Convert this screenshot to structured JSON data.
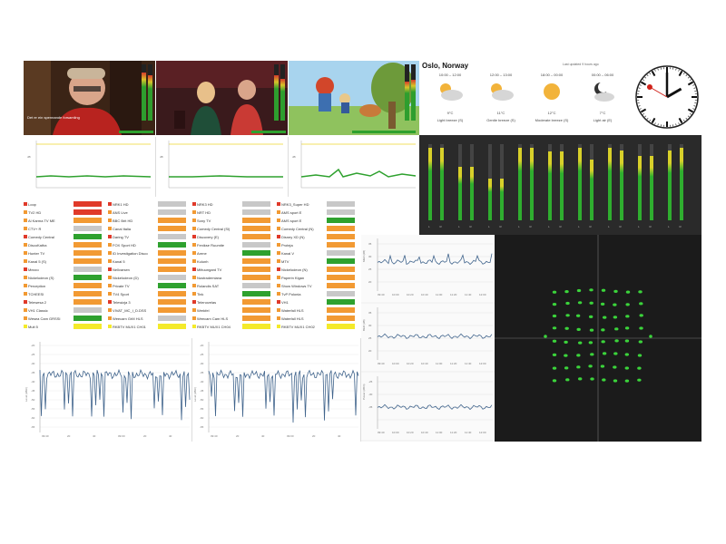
{
  "weather": {
    "city": "Oslo, Norway",
    "updated": "Last updated 9 hours ago",
    "periods": [
      {
        "time": "10:00 – 12:00",
        "temp": "9°C",
        "wind": "Light breeze (S)",
        "icon": "partly-cloudy-icon"
      },
      {
        "time": "12:00 – 13:00",
        "temp": "11°C",
        "wind": "Gentle breeze (S)",
        "icon": "partly-cloudy-icon"
      },
      {
        "time": "18:00 – 00:00",
        "temp": "12°C",
        "wind": "Moderate breeze (S)",
        "icon": "sun-icon"
      },
      {
        "time": "00:00 – 06:00",
        "temp": "7°C",
        "wind": "Light air (E)",
        "icon": "moon-cloud-icon"
      }
    ]
  },
  "clock": {
    "hour": 2,
    "minute": 0,
    "second": 50
  },
  "videos": [
    {
      "name": "video-tile-1",
      "subtitle": "Det er ein spennande forsamling",
      "level": 0.85
    },
    {
      "name": "video-tile-2",
      "subtitle": "",
      "level": 0.8
    },
    {
      "name": "video-tile-3",
      "subtitle": "",
      "level": 0.7
    }
  ],
  "status_services": [
    [
      "Loop",
      "NRK1 HD",
      "NRK3 HD",
      "NRK3_Super HD"
    ],
    [
      "TV2 HD",
      "ANS Live",
      "NRT HD",
      "AMS sport E"
    ],
    [
      "Al Karma TV ME",
      "BBC Brit HD",
      "Sony TV",
      "AMS sport E"
    ],
    [
      "CTV+ R",
      "Canal Italia",
      "Comedy Central (Sl)",
      "Comedy Central (N)"
    ],
    [
      "Comedy Central",
      "Daring TV",
      "Discovery (E)",
      "Disney XD (N)"
    ],
    [
      "DiscoKatha",
      "FOX Sport HD",
      "Fenikse Ruumite",
      "Proteja"
    ],
    [
      "Hunter TV",
      "ID Investigation Disco",
      "Arene",
      "Kanal V"
    ],
    [
      "Kanal 5 (S)",
      "Kanal 5",
      "Kulunh",
      "MTV"
    ],
    [
      "Mezzo",
      "Nellvarsen",
      "Mittuungard TV",
      "Nickelodeon (N)"
    ],
    [
      "Nickelodeon (S)",
      "Nickelodeon (D)",
      "Nustrademiana",
      "Paperin Klgan"
    ],
    [
      "Perception",
      "Private TV",
      "Rolandis SAT",
      "Show Windows TV"
    ],
    [
      "TCHEESI",
      "TV4 Sport",
      "Tink",
      "TvP Polonia"
    ],
    [
      "Telewesa 2",
      "Telewizja 3",
      "Telenovelas",
      "VH1"
    ],
    [
      "VH1 Classic",
      "VIVAT_MC_I_D.DSS",
      "Werkfel",
      "Waterfall HLS"
    ],
    [
      "Wesea Cam GRSSI",
      "Weecam GrM HLS",
      "Weecam Cam HLS",
      "Waterfall HLS"
    ],
    [
      "Mult 5",
      "RKBTV MUX1 CH01",
      "RKBTV MUX1 CH04",
      "RKBTV MUX1 CH02"
    ]
  ],
  "colors": {
    "ok": "#2ea12e",
    "warn": "#f29a33",
    "error": "#e03a2a",
    "idle": "#c8c8c8",
    "info": "#f4ea2a",
    "meter_green": "#2fae2f",
    "meter_yellow": "#d8d02a",
    "line_blue": "#40648c"
  },
  "mini_charts": {
    "ylabel": "dB",
    "xticks": [
      "05:40",
      "05",
      "20",
      "45",
      "09:00",
      "15",
      "30",
      "45"
    ]
  },
  "audio_meters": {
    "count": 18,
    "labels": [
      "L",
      "R",
      "L",
      "R",
      "L",
      "R",
      "L",
      "R",
      "L",
      "R",
      "L",
      "R",
      "L",
      "R",
      "L",
      "R",
      "L",
      "R"
    ]
  },
  "right_charts": [
    {
      "ylabel": "MER (dB)",
      "yticks": [
        "35",
        "30",
        "25",
        "20"
      ],
      "xticks": [
        "09:40",
        "10:00",
        "10:20",
        "10:40",
        "11:00",
        "11:20",
        "11:40",
        "12:00"
      ]
    },
    {
      "ylabel": "BER (dB)",
      "yticks": [
        "35",
        "30",
        "25",
        "20"
      ],
      "xticks": [
        "09:40",
        "10:00",
        "10:20",
        "10:40",
        "11:00",
        "11:20",
        "11:40",
        "12:00"
      ]
    },
    {
      "ylabel": "Power (dBm)",
      "yticks": [
        "-25",
        "-30",
        "-35"
      ],
      "xticks": [
        "09:40",
        "10:00",
        "10:20",
        "10:40",
        "11:00",
        "11:20",
        "11:40",
        "12:00"
      ]
    }
  ],
  "bottom_charts": [
    {
      "ylabel": "Level (dBm)",
      "yticks": [
        "-20",
        "-25",
        "-30",
        "-35",
        "-40",
        "-45",
        "-50",
        "-55",
        "-60",
        "-65"
      ],
      "xticks": [
        "09:40",
        "20",
        "40",
        "09:00",
        "20",
        "40"
      ]
    },
    {
      "ylabel": "Level (dBm)",
      "yticks": [
        "-20",
        "-25",
        "-30",
        "-35",
        "-40",
        "-45",
        "-50",
        "-55",
        "-60",
        "-65"
      ],
      "xticks": [
        "09:40",
        "20",
        "40",
        "09:00",
        "20",
        "40"
      ]
    }
  ]
}
